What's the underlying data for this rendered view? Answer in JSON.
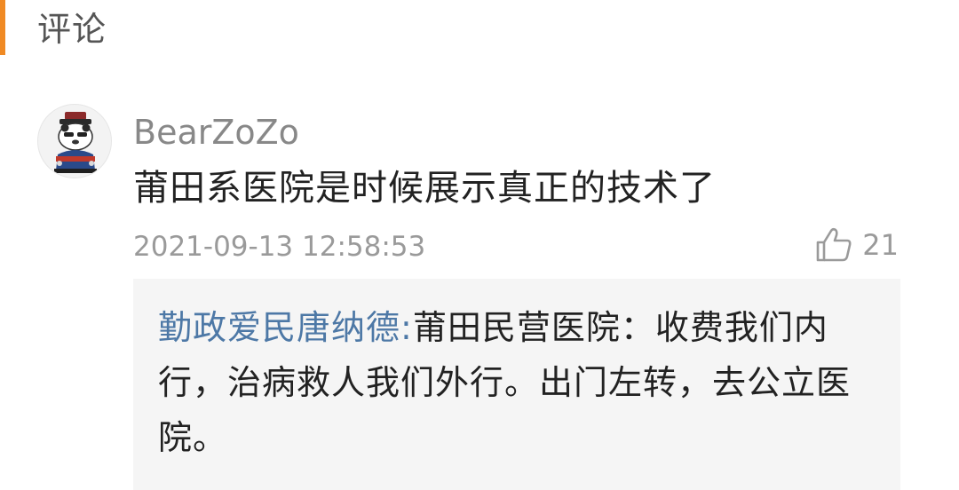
{
  "section": {
    "title": "评论",
    "accent_color": "#f08a24"
  },
  "comment": {
    "avatar_icon": "bear-avatar-icon",
    "username": "BearZoZo",
    "text": "莆田系医院是时候展示真正的技术了",
    "timestamp": "2021-09-13 12:58:53",
    "like_icon": "thumbs-up-icon",
    "like_count": "21"
  },
  "reply": {
    "author": "勤政爱民唐纳德:",
    "text": "莆田民营医院：收费我们内行，治病救人我们外行。出门左转，去公立医院。",
    "author_color": "#4d78a6",
    "background": "#f5f5f5"
  }
}
